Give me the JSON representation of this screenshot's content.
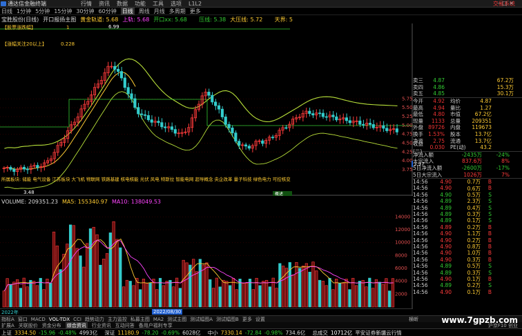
{
  "titlebar": {
    "app_name": "通达信金融终端",
    "menus": [
      "行情",
      "资讯",
      "数据",
      "功能",
      "工具",
      "选项",
      "L1L2"
    ],
    "trade": "交易系统",
    "controls": "– □ ×"
  },
  "periodbar": {
    "items": [
      "日线",
      "1分钟",
      "5分钟",
      "15分钟",
      "30分钟",
      "60分钟",
      "日线",
      "周线",
      "月线",
      "多周期",
      "更多"
    ],
    "active_index": 6
  },
  "chart_header": {
    "stock": "宝胜股份(日线)",
    "tag1": "开口报扬主图",
    "tag2": "黄金轨道: 5.68",
    "tag3": "上轨: 5.68",
    "tag4": "开口xx: 5.68",
    "tag5": "压线: 5.38",
    "tag6": "大压线: 5.72",
    "tag7": "天界: 5"
  },
  "chart_labels": {
    "l1": "【股票涨跌幅】",
    "l1v": "1",
    "l2": "【涨幅关注20以上】",
    "l2v": "0.228",
    "high_mark": "6.99",
    "low_mark": "3.48",
    "current_price": "3.97",
    "concepts": "所属板块: 储能  电气设备  江苏板块  大飞机  物联网  铁路基建  核电核能  光伏  风电  特斯拉  智能电网  超导概念  央企改革  量子科技  绿色电力  可控核变",
    "boxtag": "概述"
  },
  "price_axis": [
    "5.75",
    "5.50",
    "5.25",
    "5.00",
    "4.75",
    "4.50",
    "4.25",
    "4.00",
    "3.75"
  ],
  "volume_header": {
    "volume": "VOLUME: 209351.23",
    "ma5": "MA5: 155340.97",
    "ma10": "MA10: 138049.53"
  },
  "volume_axis": [
    "14000",
    "12000",
    "10000",
    "8000",
    "6000",
    "4000",
    "2000"
  ],
  "date_label": "2022/08/30",
  "date_axis_left": "2022年",
  "quote": {
    "ask": [
      [
        "卖三",
        "4.87",
        "67.2万"
      ],
      [
        "卖四",
        "4.86",
        "15.3万"
      ],
      [
        "卖五",
        "4.85",
        "30.1万"
      ]
    ],
    "stats": [
      [
        "今开",
        "4.92",
        "均价",
        "4.87"
      ],
      [
        "最高",
        "4.94",
        "量比",
        "1.27"
      ],
      [
        "最低",
        "4.80",
        "市值",
        "67.2亿"
      ],
      [
        "现量",
        "1133",
        "总量",
        "209351"
      ],
      [
        "外盘",
        "89726",
        "内盘",
        "119673"
      ],
      [
        "换手",
        "1.53%",
        "股本",
        "13.7亿"
      ],
      [
        "净资",
        "2.75",
        "流通",
        "13.7亿"
      ],
      [
        "收益(二)",
        "0.030",
        "PE(动)",
        "43.2"
      ]
    ],
    "flows": [
      [
        "净流入额",
        "-2435万",
        "-24%"
      ],
      [
        "大宗流入",
        "837.6万",
        "8%"
      ],
      [
        "5日净流入额",
        "-2600万",
        "-17%"
      ],
      [
        "5日大宗流入",
        "1026万",
        "7%"
      ]
    ],
    "ticks": [
      [
        "14:56",
        "4.90",
        "0.7万",
        "B"
      ],
      [
        "14:56",
        "4.90",
        "0.6万",
        "B"
      ],
      [
        "14:56",
        "4.90",
        "0.5万",
        "S"
      ],
      [
        "14:56",
        "4.89",
        "2.3万",
        "S"
      ],
      [
        "14:56",
        "4.89",
        "0.4万",
        "S"
      ],
      [
        "14:56",
        "4.89",
        "0.3万",
        "S"
      ],
      [
        "14:56",
        "4.89",
        "0.1万",
        "S"
      ],
      [
        "14:56",
        "4.89",
        "0.2万",
        "B"
      ],
      [
        "14:56",
        "4.90",
        "1.1万",
        "B"
      ],
      [
        "14:56",
        "4.90",
        "0.2万",
        "B"
      ],
      [
        "14:56",
        "4.90",
        "0.8万",
        "B"
      ],
      [
        "14:56",
        "4.90",
        "1.0万",
        "B"
      ],
      [
        "14:56",
        "4.90",
        "0.3万",
        "B"
      ],
      [
        "14:56",
        "4.89",
        "0.5万",
        "S"
      ],
      [
        "14:56",
        "4.89",
        "0.3万",
        "S"
      ],
      [
        "14:56",
        "4.90",
        "0.1万",
        "B"
      ],
      [
        "14:56",
        "4.89",
        "0.2万",
        "S"
      ],
      [
        "14:56",
        "4.90",
        "0.1万",
        "B"
      ]
    ]
  },
  "tabbar": {
    "items": [
      "指标A",
      "窗口",
      "MACD",
      "VOL-TDX",
      "CCI",
      "趋势动力",
      "主力监控",
      "私募主图",
      "MA2",
      "测试主图",
      "测试幅图A",
      "测试幅图B",
      "更多",
      "设置"
    ],
    "right": "横断"
  },
  "funcbar": {
    "items": [
      "扩展A",
      "关联股价",
      "资金分布",
      "综合资讯",
      "行业资讯",
      "互动问答",
      "备用户福利专享"
    ],
    "active_index": 3,
    "right": "沪京F10 创业"
  },
  "indexbar": {
    "sh": [
      "上证",
      "3334.50",
      "-15.96",
      "-0.48%",
      "4993亿"
    ],
    "sz": [
      "深证",
      "11180.9",
      "-78.20",
      "-0.69%",
      "6028亿"
    ],
    "zx": [
      "中小",
      "7330.14",
      "-72.84",
      "-0.98%",
      "734.6亿"
    ],
    "total": [
      "总成交",
      "10712亿"
    ],
    "note": "平安证券新疆云行情"
  },
  "watermark": "www.7gpzb.com"
}
